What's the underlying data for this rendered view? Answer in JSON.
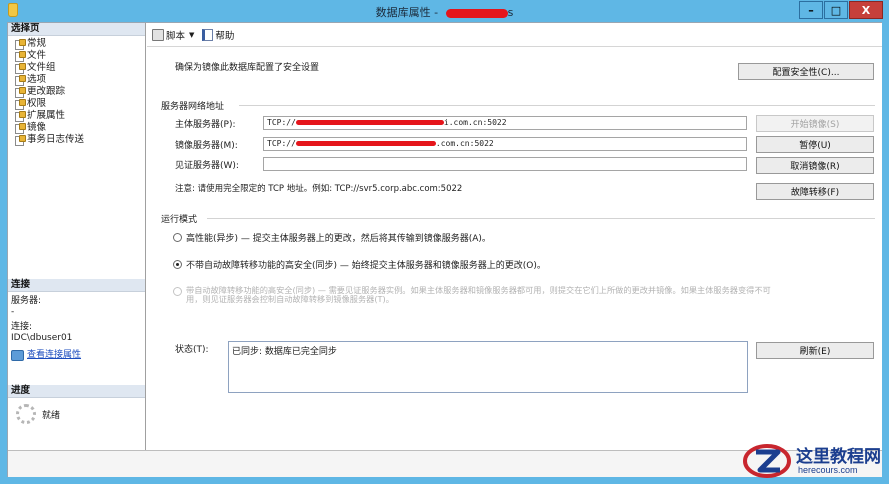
{
  "window": {
    "title": "数据库属性 - ",
    "title_suffix": "s",
    "min_label": "–",
    "max_label": "□",
    "close_label": "X"
  },
  "left_pane": {
    "select_page_header": "选择页",
    "pages": [
      {
        "label": "常规"
      },
      {
        "label": "文件"
      },
      {
        "label": "文件组"
      },
      {
        "label": "选项"
      },
      {
        "label": "更改跟踪"
      },
      {
        "label": "权限"
      },
      {
        "label": "扩展属性"
      },
      {
        "label": "镜像"
      },
      {
        "label": "事务日志传送"
      }
    ],
    "connection_header": "连接",
    "server_label": "服务器:",
    "server_value": "-",
    "connection_label": "连接:",
    "connection_value": "IDC\\dbuser01",
    "view_connection_link": "查看连接属性",
    "progress_header": "进度",
    "progress_status": "就绪"
  },
  "toolbar": {
    "script_label": "脚本",
    "help_label": "帮助"
  },
  "mirroring": {
    "intro_text": "确保为镜像此数据库配置了安全设置",
    "configure_security_button": "配置安全性(C)...",
    "server_address_group": "服务器网络地址",
    "principal_label": "主体服务器(P):",
    "principal_prefix": "TCP://",
    "principal_suffix": "i.com.cn:5022",
    "mirror_label": "镜像服务器(M):",
    "mirror_prefix": "TCP://",
    "mirror_suffix": ".com.cn:5022",
    "witness_label": "见证服务器(W):",
    "witness_value": "",
    "start_mirroring_button": "开始镜像(S)",
    "pause_button": "暂停(U)",
    "remove_mirroring_button": "取消镜像(R)",
    "failover_button": "故障转移(F)",
    "note_text": "注意: 请使用完全限定的 TCP 地址。例如: TCP://svr5.corp.abc.com:5022",
    "operating_mode_group": "运行模式",
    "mode_high_performance": "高性能(异步) — 提交主体服务器上的更改，然后将其传输到镜像服务器(A)。",
    "mode_high_safety": "不带自动故障转移功能的高安全(同步) — 始终提交主体服务器和镜像服务器上的更改(O)。",
    "mode_auto_failover_line1": "带自动故障转移功能的高安全(同步) — 需要见证服务器实例。如果主体服务器和镜像服务器都可用，则提交在它们上所做的更改并镜像。如果主体服务器变得不可",
    "mode_auto_failover_line2": "用，则见证服务器会控制自动故障转移到镜像服务器(T)。",
    "status_label": "状态(T):",
    "status_value": "已同步: 数据库已完全同步",
    "refresh_button": "刷新(E)"
  },
  "watermark": {
    "title": "这里教程网",
    "url": "herecours.com"
  },
  "colors": {
    "titlebar": "#5fb7e5",
    "close_button": "#c6403a",
    "redaction": "#e5151b",
    "link": "#1a4bbd",
    "watermark": "#1b3e8f"
  }
}
